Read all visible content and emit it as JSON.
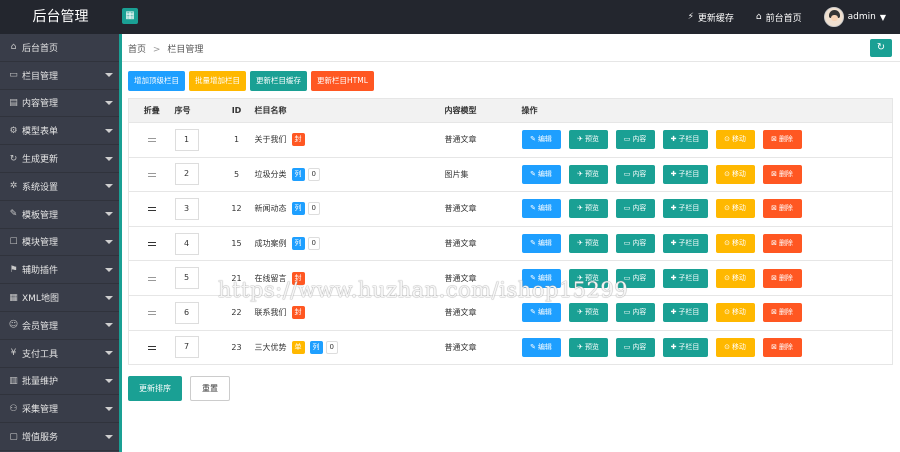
{
  "app": {
    "brand": "后台管理",
    "toggle_icon": "grid-icon",
    "top_links": [
      {
        "label": "更新缓存",
        "icon": "refresh-icon"
      },
      {
        "label": "前台首页",
        "icon": "home-icon"
      }
    ],
    "user": {
      "name": "admin"
    }
  },
  "sidebar": {
    "items": [
      {
        "label": "后台首页",
        "icon": "⌂",
        "has_caret": false
      },
      {
        "label": "栏目管理",
        "icon": "▭",
        "has_caret": true
      },
      {
        "label": "内容管理",
        "icon": "▤",
        "has_caret": true
      },
      {
        "label": "模型表单",
        "icon": "⚙",
        "has_caret": true
      },
      {
        "label": "生成更新",
        "icon": "↻",
        "has_caret": true
      },
      {
        "label": "系统设置",
        "icon": "✲",
        "has_caret": true
      },
      {
        "label": "模板管理",
        "icon": "✎",
        "has_caret": true
      },
      {
        "label": "模块管理",
        "icon": "☐",
        "has_caret": true
      },
      {
        "label": "辅助插件",
        "icon": "⚑",
        "has_caret": true
      },
      {
        "label": "XML地图",
        "icon": "▦",
        "has_caret": true
      },
      {
        "label": "会员管理",
        "icon": "☺",
        "has_caret": true
      },
      {
        "label": "支付工具",
        "icon": "¥",
        "has_caret": true
      },
      {
        "label": "批量维护",
        "icon": "▥",
        "has_caret": true
      },
      {
        "label": "采集管理",
        "icon": "⚇",
        "has_caret": true
      },
      {
        "label": "增值服务",
        "icon": "▢",
        "has_caret": true
      }
    ]
  },
  "breadcrumb": {
    "home": "首页",
    "separator": ">",
    "current": "栏目管理"
  },
  "actions": [
    {
      "label": "增加顶级栏目",
      "color": "#1e9fff"
    },
    {
      "label": "批量增加栏目",
      "color": "#ffb800"
    },
    {
      "label": "更新栏目缓存",
      "color": "#1aa094"
    },
    {
      "label": "更新栏目HTML",
      "color": "#ff5722"
    }
  ],
  "table": {
    "headers": {
      "fold": "折叠",
      "seq": "序号",
      "id": "ID",
      "name": "栏目名称",
      "model": "内容模型",
      "ops": "操作"
    },
    "op_buttons": [
      {
        "label": "编辑",
        "icon": "✎",
        "color": "#1e9fff"
      },
      {
        "label": "预览",
        "icon": "✈",
        "color": "#1aa094"
      },
      {
        "label": "内容",
        "icon": "▭",
        "color": "#1aa094"
      },
      {
        "label": "子栏目",
        "icon": "✚",
        "color": "#1aa094"
      },
      {
        "label": "移动",
        "icon": "⊙",
        "color": "#ffb800"
      },
      {
        "label": "删除",
        "icon": "⊠",
        "color": "#ff5722"
      }
    ],
    "rows": [
      {
        "seq": "1",
        "id": "1",
        "name": "关于我们",
        "tags": [
          {
            "text": "封",
            "color": "orange"
          }
        ],
        "count": "",
        "model": "普通文章"
      },
      {
        "seq": "2",
        "id": "5",
        "name": "垃圾分类",
        "tags": [
          {
            "text": "列",
            "color": "blue"
          }
        ],
        "count": "0",
        "model": "图片集"
      },
      {
        "seq": "3",
        "id": "12",
        "name": "新闻动态",
        "tags": [
          {
            "text": "列",
            "color": "blue"
          }
        ],
        "count": "0",
        "model": "普通文章"
      },
      {
        "seq": "4",
        "id": "15",
        "name": "成功案例",
        "tags": [
          {
            "text": "列",
            "color": "blue"
          }
        ],
        "count": "0",
        "model": "普通文章"
      },
      {
        "seq": "5",
        "id": "21",
        "name": "在线留言",
        "tags": [
          {
            "text": "封",
            "color": "orange"
          }
        ],
        "count": "",
        "model": "普通文章"
      },
      {
        "seq": "6",
        "id": "22",
        "name": "联系我们",
        "tags": [
          {
            "text": "封",
            "color": "orange"
          }
        ],
        "count": "",
        "model": "普通文章"
      },
      {
        "seq": "7",
        "id": "23",
        "name": "三大优势",
        "tags": [
          {
            "text": "单",
            "color": "yellow"
          },
          {
            "text": "列",
            "color": "blue"
          }
        ],
        "count": "0",
        "model": "普通文章"
      }
    ]
  },
  "bottom": {
    "update_sort": "更新排序",
    "reset": "重置"
  },
  "watermark": "https://www.huzhan.com/ishop15299"
}
